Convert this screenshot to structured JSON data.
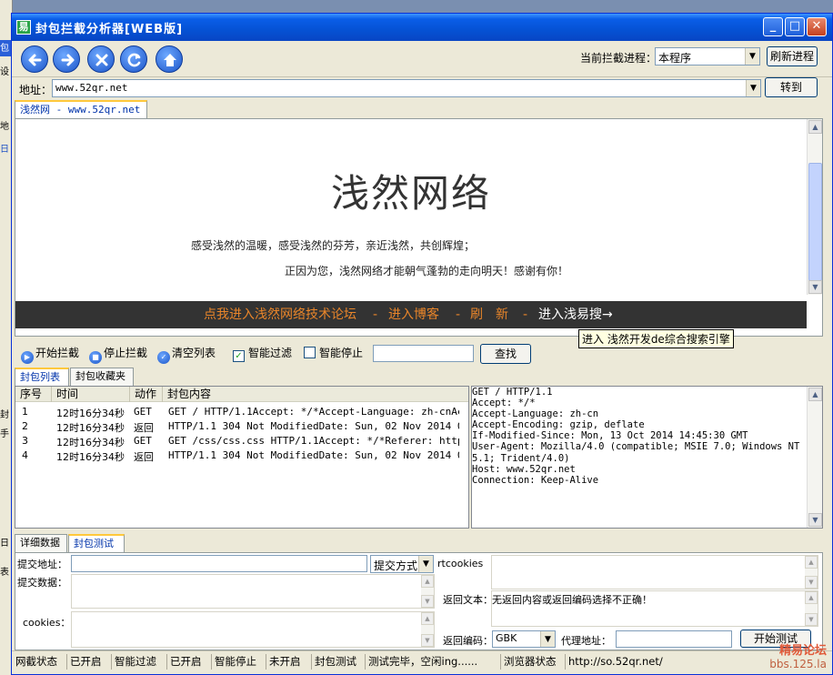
{
  "window": {
    "title": "封包拦截分析器[WEB版]",
    "app_icon_glyph": "易"
  },
  "toolbar": {
    "nav_icons": [
      "back-icon",
      "forward-icon",
      "stop-icon",
      "refresh-icon",
      "home-icon"
    ],
    "process_label": "当前拦截进程：",
    "process_value": "本程序",
    "refresh_process_label": "刷新进程"
  },
  "address": {
    "label": "地址：",
    "value": "www.52qr.net",
    "go_label": "转到"
  },
  "browser_tab": {
    "label": "浅然网 - www.52qr.net"
  },
  "site": {
    "title": "浅然网络",
    "line1": "感受浅然的温暖，感受浅然的芬芳，亲近浅然，共创辉煌；",
    "line2": "正因为您，浅然网络才能朝气蓬勃的走向明天！感谢有你！",
    "nav": [
      "点我进入浅然网络技术论坛",
      "-",
      "进入博客",
      "-",
      "刷　新",
      "-",
      "进入浅易搜→"
    ],
    "tooltip": "进入 浅然开发de综合搜索引擎"
  },
  "controls": {
    "start_label": "开始拦截",
    "stop_label": "停止拦截",
    "clear_label": "清空列表",
    "smart_filter_label": "智能过滤",
    "smart_filter_checked": true,
    "smart_stop_label": "智能停止",
    "smart_stop_checked": false,
    "search_value": "",
    "find_label": "查找"
  },
  "list_tabs": [
    "封包列表",
    "封包收藏夹"
  ],
  "packet_table": {
    "headers": [
      "序号",
      "时间",
      "动作",
      "封包内容"
    ],
    "rows": [
      [
        "1",
        "12时16分34秒",
        "GET",
        "GET / HTTP/1.1Accept: */*Accept-Language: zh-cnAcc..."
      ],
      [
        "2",
        "12时16分34秒",
        "返回",
        "HTTP/1.1 304 Not ModifiedDate: Sun, 02 Nov 2014 04..."
      ],
      [
        "3",
        "12时16分34秒",
        "GET",
        "GET /css/css.css HTTP/1.1Accept: */*Referer: http:..."
      ],
      [
        "4",
        "12时16分34秒",
        "返回",
        "HTTP/1.1 304 Not ModifiedDate: Sun, 02 Nov 2014 04..."
      ]
    ]
  },
  "packet_detail": [
    "GET / HTTP/1.1",
    "Accept: */*",
    "Accept-Language: zh-cn",
    "Accept-Encoding: gzip, deflate",
    "If-Modified-Since: Mon, 13 Oct 2014 14:45:30 GMT",
    "User-Agent: Mozilla/4.0 (compatible; MSIE 7.0; Windows NT",
    "5.1; Trident/4.0)",
    "Host: www.52qr.net",
    "Connection: Keep-Alive"
  ],
  "bottom_tabs": [
    "详细数据",
    "封包测试"
  ],
  "test_form": {
    "submit_url_label": "提交地址：",
    "submit_method_value": "提交方式",
    "rtcookies_label": "rtcookies",
    "submit_data_label": "提交数据：",
    "return_text_label": "返回文本：",
    "return_text_value": "无返回内容或返回编码选择不正确！",
    "cookies_label": "cookies：",
    "return_encoding_label": "返回编码：",
    "return_encoding_value": "GBK",
    "proxy_label": "代理地址：",
    "start_test_label": "开始测试"
  },
  "statusbar": [
    "网截状态",
    "已开启",
    "智能过滤",
    "已开启",
    "智能停止",
    "未开启",
    "封包测试",
    "测试完毕，空闲ing......",
    "浏览器状态",
    "http://so.52qr.net/"
  ],
  "watermark": {
    "line1": "精易论坛",
    "line2": "bbs.125.la"
  },
  "background_window": {
    "items": [
      "包",
      "设",
      "地",
      "日",
      "封",
      "手",
      "日",
      "表"
    ]
  },
  "colors": {
    "title_blue": "#0552d4",
    "site_nav_bg": "#333333",
    "site_nav_text": "#e8852a",
    "tab_highlight": "#ffc83c"
  }
}
